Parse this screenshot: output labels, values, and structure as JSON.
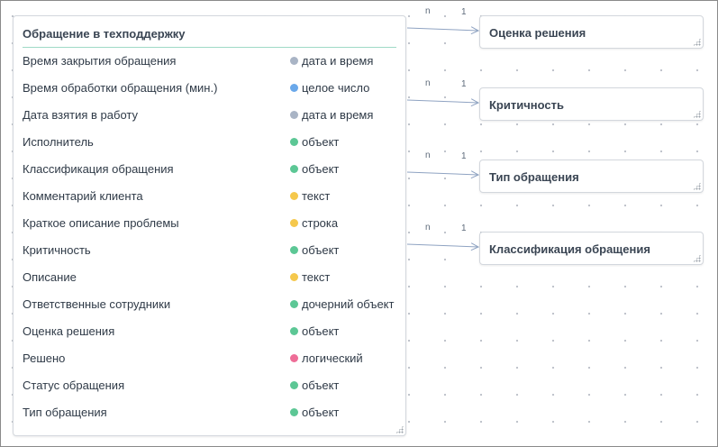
{
  "main_entity": {
    "title": "Обращение в техподдержку",
    "fields": [
      {
        "name": "Время закрытия обращения",
        "type": "дата и время",
        "color": "#a9b4c5"
      },
      {
        "name": "Время обработки обращения (мин.)",
        "type": "целое число",
        "color": "#6aa8ea"
      },
      {
        "name": "Дата взятия в работу",
        "type": "дата и время",
        "color": "#a9b4c5"
      },
      {
        "name": "Исполнитель",
        "type": "объект",
        "color": "#5cc795"
      },
      {
        "name": "Классификация обращения",
        "type": "объект",
        "color": "#5cc795"
      },
      {
        "name": "Комментарий клиента",
        "type": "текст",
        "color": "#f5c84c"
      },
      {
        "name": "Краткое описание проблемы",
        "type": "строка",
        "color": "#f5c84c"
      },
      {
        "name": "Критичность",
        "type": "объект",
        "color": "#5cc795"
      },
      {
        "name": "Описание",
        "type": "текст",
        "color": "#f5c84c"
      },
      {
        "name": "Ответственные сотрудники",
        "type": "дочерний объект",
        "color": "#5cc795"
      },
      {
        "name": "Оценка решения",
        "type": "объект",
        "color": "#5cc795"
      },
      {
        "name": "Решено",
        "type": "логический",
        "color": "#ee6d97"
      },
      {
        "name": "Статус обращения",
        "type": "объект",
        "color": "#5cc795"
      },
      {
        "name": "Тип обращения",
        "type": "объект",
        "color": "#5cc795"
      }
    ]
  },
  "related_entities": [
    {
      "title": "Оценка решения",
      "from_cardinality": "n",
      "to_cardinality": "1"
    },
    {
      "title": "Критичность",
      "from_cardinality": "n",
      "to_cardinality": "1"
    },
    {
      "title": "Тип обращения",
      "from_cardinality": "n",
      "to_cardinality": "1"
    },
    {
      "title": "Классификация обращения",
      "from_cardinality": "n",
      "to_cardinality": "1"
    }
  ],
  "colors": {
    "link_line": "#8fa3c2",
    "title_underline": "#9fdac6"
  }
}
